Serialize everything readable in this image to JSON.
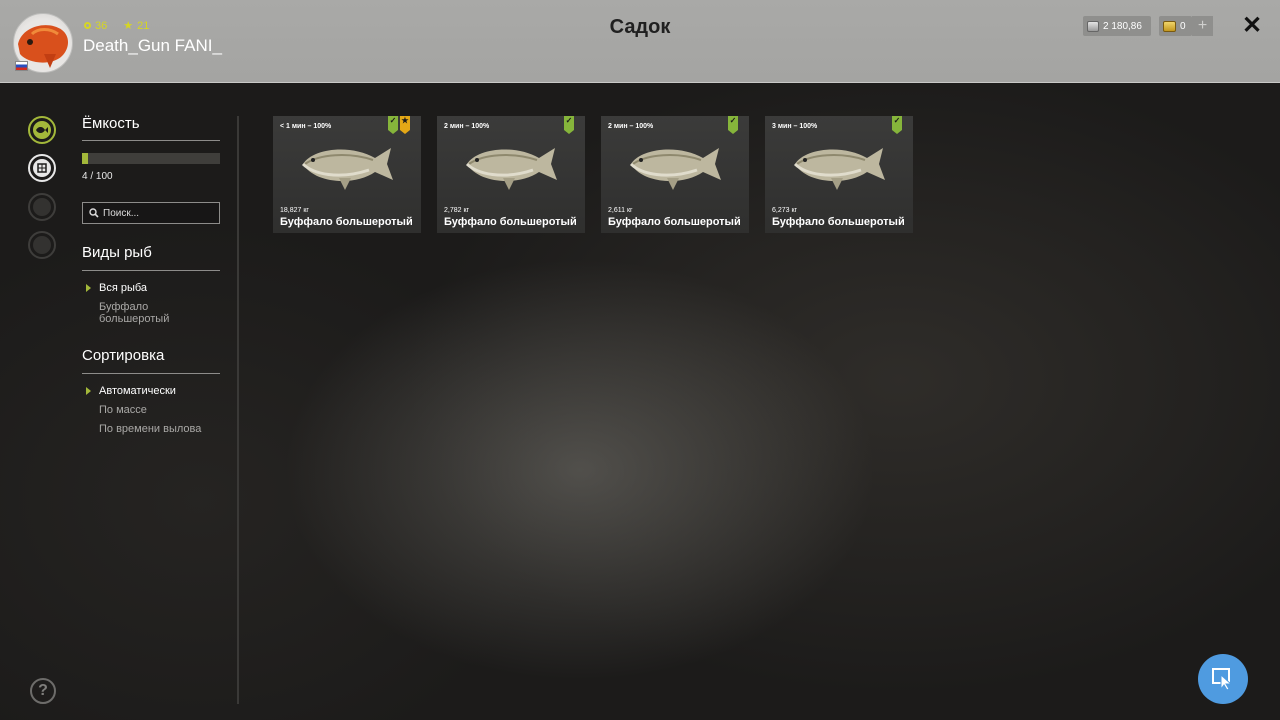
{
  "header": {
    "title": "Садок",
    "username": "Death_Gun FANI_",
    "level": "36",
    "rank": "21",
    "silver": "2 180,86",
    "gold": "0",
    "add_label": "+",
    "close_label": "✕"
  },
  "sidebar": {
    "capacity_title": "Ёмкость",
    "capacity_text": "4 / 100",
    "capacity_fraction": 0.04,
    "search_placeholder": "Поиск...",
    "species_title": "Виды рыб",
    "species": [
      "Вся рыба",
      "Буффало большеротый"
    ],
    "sort_title": "Сортировка",
    "sort_options": [
      "Автоматически",
      "По массе",
      "По времени вылова"
    ],
    "help_label": "?"
  },
  "cards": [
    {
      "time": "< 1 мин – 100%",
      "weight": "18,827 кг",
      "name": "Буффало большеротый"
    },
    {
      "time": "2 мин – 100%",
      "weight": "2,782 кг",
      "name": "Буффало большеротый"
    },
    {
      "time": "2 мин – 100%",
      "weight": "2,611 кг",
      "name": "Буффало большеротый"
    },
    {
      "time": "3 мин – 100%",
      "weight": "6,273 кг",
      "name": "Буффало большеротый"
    }
  ],
  "colors": {
    "accent": "#a3b83a",
    "badge_green": "#86b53b",
    "badge_yellow": "#e4a816",
    "cursor_button": "#4f9be0"
  }
}
